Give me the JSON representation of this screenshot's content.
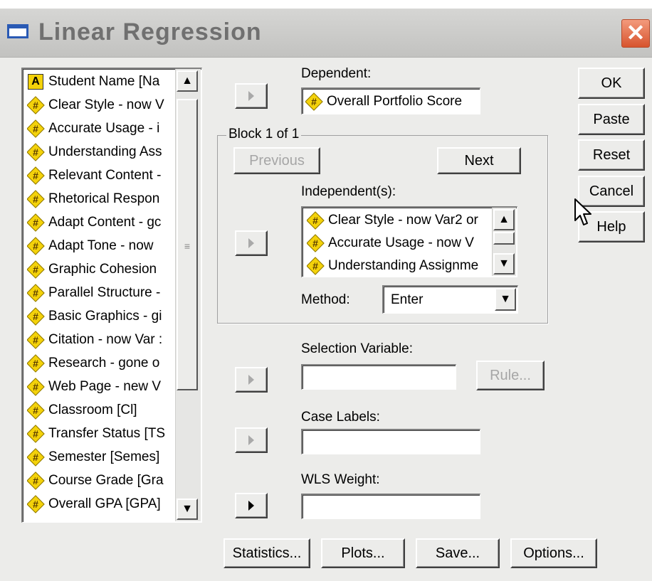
{
  "window": {
    "title": "Linear Regression"
  },
  "variables": [
    {
      "label": "Student Name [Na",
      "type": "string"
    },
    {
      "label": "Clear Style - now V",
      "type": "numeric"
    },
    {
      "label": "Accurate Usage - i",
      "type": "numeric"
    },
    {
      "label": "Understanding Ass",
      "type": "numeric"
    },
    {
      "label": "Relevant Content -",
      "type": "numeric"
    },
    {
      "label": "Rhetorical Respon",
      "type": "numeric"
    },
    {
      "label": "Adapt Content - gc",
      "type": "numeric"
    },
    {
      "label": "Adapt Tone - now",
      "type": "numeric"
    },
    {
      "label": "Graphic Cohesion",
      "type": "numeric"
    },
    {
      "label": "Parallel Structure -",
      "type": "numeric"
    },
    {
      "label": "Basic Graphics - gi",
      "type": "numeric"
    },
    {
      "label": "Citation - now Var :",
      "type": "numeric"
    },
    {
      "label": "Research - gone o",
      "type": "numeric"
    },
    {
      "label": "Web Page - new V",
      "type": "numeric"
    },
    {
      "label": "Classroom [Cl]",
      "type": "numeric"
    },
    {
      "label": "Transfer Status [TS",
      "type": "numeric"
    },
    {
      "label": "Semester [Semes]",
      "type": "numeric"
    },
    {
      "label": "Course Grade [Gra",
      "type": "numeric"
    },
    {
      "label": "Overall GPA [GPA]",
      "type": "numeric"
    }
  ],
  "dependent": {
    "label": "Dependent:",
    "value": "Overall Portfolio Score"
  },
  "block": {
    "label": "Block 1 of 1",
    "previous_label": "Previous",
    "next_label": "Next",
    "independent_label": "Independent(s):",
    "independents": [
      "Clear Style - now Var2 or",
      "Accurate Usage - now V",
      "Understanding Assignme"
    ],
    "method_label": "Method:",
    "method_value": "Enter"
  },
  "selection": {
    "label": "Selection Variable:",
    "value": "",
    "rule_label": "Rule..."
  },
  "case_labels": {
    "label": "Case Labels:",
    "value": ""
  },
  "wls": {
    "label": "WLS Weight:",
    "value": ""
  },
  "side_buttons": {
    "ok": "OK",
    "paste": "Paste",
    "reset": "Reset",
    "cancel": "Cancel",
    "help": "Help"
  },
  "bottom_buttons": {
    "statistics": "Statistics...",
    "plots": "Plots...",
    "save": "Save...",
    "options": "Options..."
  },
  "icons": {
    "numeric": "numeric-variable-icon",
    "string": "string-variable-icon"
  },
  "colors": {
    "dialog_bg": "#ececea",
    "title_accent": "#2a5ab4",
    "close_red": "#d7542e",
    "variable_icon": "#f4d20a"
  }
}
